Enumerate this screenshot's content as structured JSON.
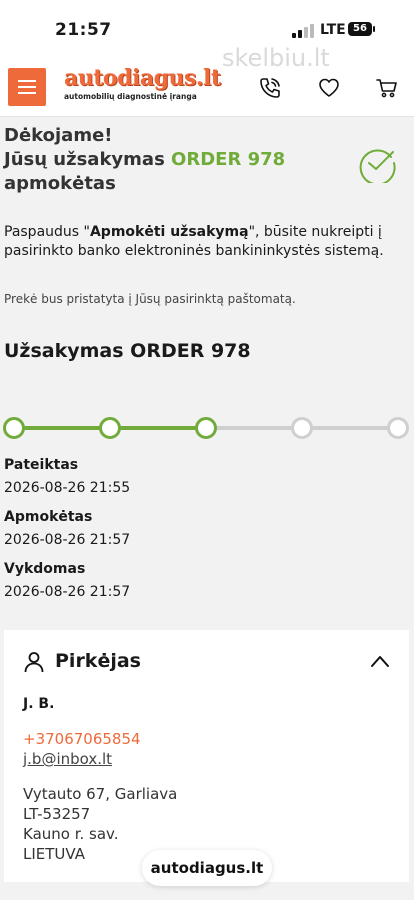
{
  "status_bar": {
    "time": "21:57",
    "network": "LTE",
    "battery": "56"
  },
  "header": {
    "logo_text": "autodiagus.lt",
    "logo_tagline": "automobilių diagnostinė įranga",
    "watermark": "skelbiu.lt",
    "icons": [
      "menu-icon",
      "phone-icon",
      "heart-icon",
      "cart-icon"
    ]
  },
  "confirmation": {
    "line1": "Dėkojame!",
    "line2_prefix": "Jūsų užsakymas ",
    "line2_order": "ORDER 978",
    "line3": "apmokėtas"
  },
  "info": {
    "p1_before": "Paspaudus \"",
    "p1_bold": "Apmokėti užsakymą",
    "p1_after": "\", būsite nukreipti į pasirinkto banko elektroninės bankininkystės sistemą.",
    "p2": "Prekė bus pristatyta į Jūsų pasirinktą paštomatą."
  },
  "order_title": "Užsakymas ORDER 978",
  "progress": {
    "completed_steps": 3,
    "total_steps": 5
  },
  "statuses": [
    {
      "label": "Pateiktas",
      "date": "2026-08-26 21:55"
    },
    {
      "label": "Apmokėtas",
      "date": "2026-08-26 21:57"
    },
    {
      "label": "Vykdomas",
      "date": "2026-08-26 21:57"
    }
  ],
  "buyer": {
    "title": "Pirkėjas",
    "name": "J. B.",
    "phone": "+37067065854",
    "email": "j.b@inbox.lt",
    "address_line1": "Vytauto 67, Garliava",
    "address_line2": "LT-53257",
    "address_line3": "Kauno r. sav.",
    "address_line4": "LIETUVA"
  },
  "site_pill": "autodiagus.lt",
  "colors": {
    "accent": "#ee6a3a",
    "success": "#71ac3a",
    "inactive": "#cfcfcf"
  }
}
